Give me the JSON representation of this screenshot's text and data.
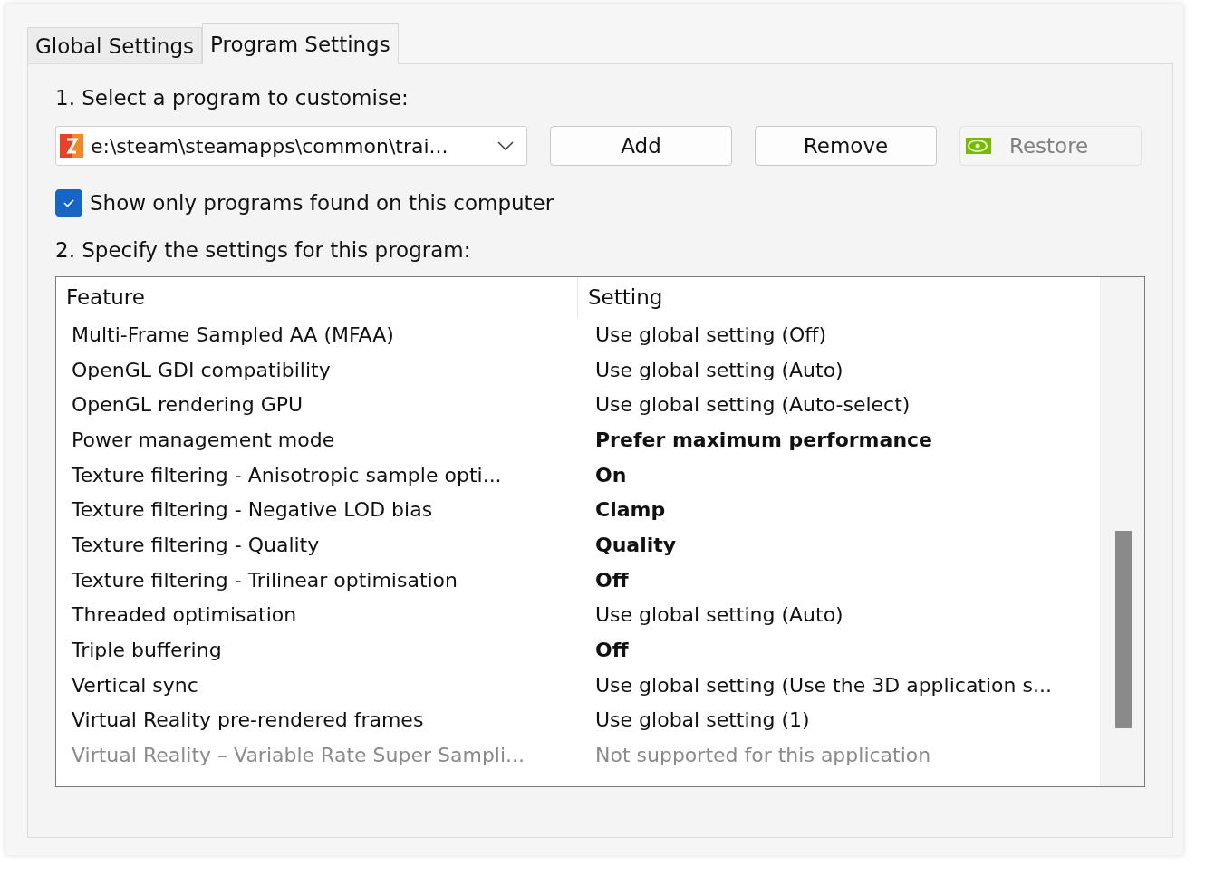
{
  "tabs": [
    {
      "label": "Global Settings",
      "selected": false
    },
    {
      "label": "Program Settings",
      "selected": true
    }
  ],
  "step1": "1. Select a program to customise:",
  "program_select": {
    "value": "e:\\steam\\steamapps\\common\\trai..."
  },
  "buttons": [
    {
      "label": "Add",
      "disabled": false
    },
    {
      "label": "Remove",
      "disabled": false
    },
    {
      "label": "Restore",
      "disabled": true
    }
  ],
  "show_only_found": {
    "label": "Show only programs found on this computer",
    "checked": true
  },
  "step2": "2. Specify the settings for this program:",
  "table": {
    "columns": [
      "Feature",
      "Setting"
    ],
    "rows": [
      {
        "feature": "Multi-Frame Sampled AA (MFAA)",
        "setting": "Use global setting (Off)",
        "kind": "global"
      },
      {
        "feature": "OpenGL GDI compatibility",
        "setting": "Use global setting (Auto)",
        "kind": "global"
      },
      {
        "feature": "OpenGL rendering GPU",
        "setting": "Use global setting (Auto-select)",
        "kind": "global"
      },
      {
        "feature": "Power management mode",
        "setting": "Prefer maximum performance",
        "kind": "custom"
      },
      {
        "feature": "Texture filtering - Anisotropic sample opti...",
        "setting": "On",
        "kind": "custom"
      },
      {
        "feature": "Texture filtering - Negative LOD bias",
        "setting": "Clamp",
        "kind": "custom"
      },
      {
        "feature": "Texture filtering - Quality",
        "setting": "Quality",
        "kind": "custom"
      },
      {
        "feature": "Texture filtering - Trilinear optimisation",
        "setting": "Off",
        "kind": "custom"
      },
      {
        "feature": "Threaded optimisation",
        "setting": "Use global setting (Auto)",
        "kind": "global"
      },
      {
        "feature": "Triple buffering",
        "setting": "Off",
        "kind": "custom"
      },
      {
        "feature": "Vertical sync",
        "setting": "Use global setting (Use the 3D application s...",
        "kind": "global"
      },
      {
        "feature": "Virtual Reality pre-rendered frames",
        "setting": "Use global setting (1)",
        "kind": "global"
      },
      {
        "feature": "Virtual Reality – Variable Rate Super Sampli...",
        "setting": "Not supported for this application",
        "kind": "unsupported"
      }
    ]
  }
}
